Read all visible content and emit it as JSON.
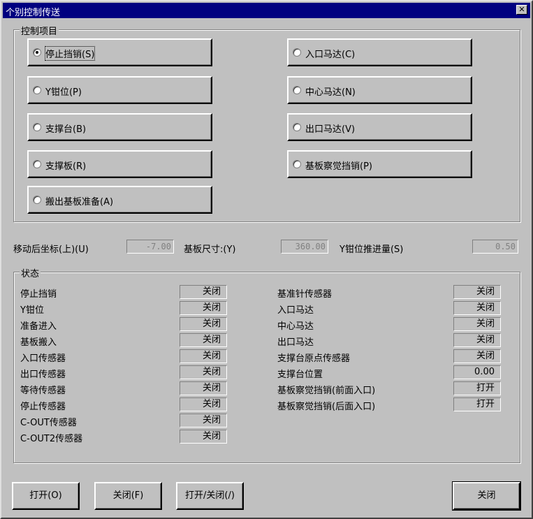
{
  "window": {
    "title": "个别控制传送",
    "close_glyph": "✕"
  },
  "control_group": {
    "label": "控制项目",
    "options_left": [
      {
        "label": "停止挡销(S)",
        "checked": true
      },
      {
        "label": "Y钳位(P)",
        "checked": false
      },
      {
        "label": "支撑台(B)",
        "checked": false
      },
      {
        "label": "支撑板(R)",
        "checked": false
      },
      {
        "label": "搬出基板准备(A)",
        "checked": false
      }
    ],
    "options_right": [
      {
        "label": "入口马达(C)",
        "checked": false
      },
      {
        "label": "中心马达(N)",
        "checked": false
      },
      {
        "label": "出口马达(V)",
        "checked": false
      },
      {
        "label": "基板察觉挡销(P)",
        "checked": false
      }
    ]
  },
  "fields": {
    "move_coord_label": "移动后坐标(上)(U)",
    "move_coord_value": "-7.00",
    "board_size_label": "基板尺寸:(Y)",
    "board_size_value": "360.00",
    "clamp_push_label": "Y钳位推进量(S)",
    "clamp_push_value": "0.50"
  },
  "status_group": {
    "label": "状态",
    "left": [
      {
        "label": "停止挡销",
        "value": "关闭"
      },
      {
        "label": "Y钳位",
        "value": "关闭"
      },
      {
        "label": "准备进入",
        "value": "关闭"
      },
      {
        "label": "基板搬入",
        "value": "关闭"
      },
      {
        "label": "入口传感器",
        "value": "关闭"
      },
      {
        "label": "出口传感器",
        "value": "关闭"
      },
      {
        "label": "等待传感器",
        "value": "关闭"
      },
      {
        "label": "停止传感器",
        "value": "关闭"
      },
      {
        "label": "C-OUT传感器",
        "value": "关闭"
      },
      {
        "label": "C-OUT2传感器",
        "value": "关闭"
      }
    ],
    "right": [
      {
        "label": "基准针传感器",
        "value": "关闭"
      },
      {
        "label": "入口马达",
        "value": "关闭"
      },
      {
        "label": "中心马达",
        "value": "关闭"
      },
      {
        "label": "出口马达",
        "value": "关闭"
      },
      {
        "label": "支撑台原点传感器",
        "value": "关闭"
      },
      {
        "label": "支撑台位置",
        "value": "0.00"
      },
      {
        "label": "基板察觉挡销(前面入口)",
        "value": "打开"
      },
      {
        "label": "基板察觉挡销(后面入口)",
        "value": "打开"
      }
    ]
  },
  "buttons": {
    "open": "打开(O)",
    "close_f": "关闭(F)",
    "toggle": "打开/关闭(/)",
    "close_dialog": "关闭"
  }
}
